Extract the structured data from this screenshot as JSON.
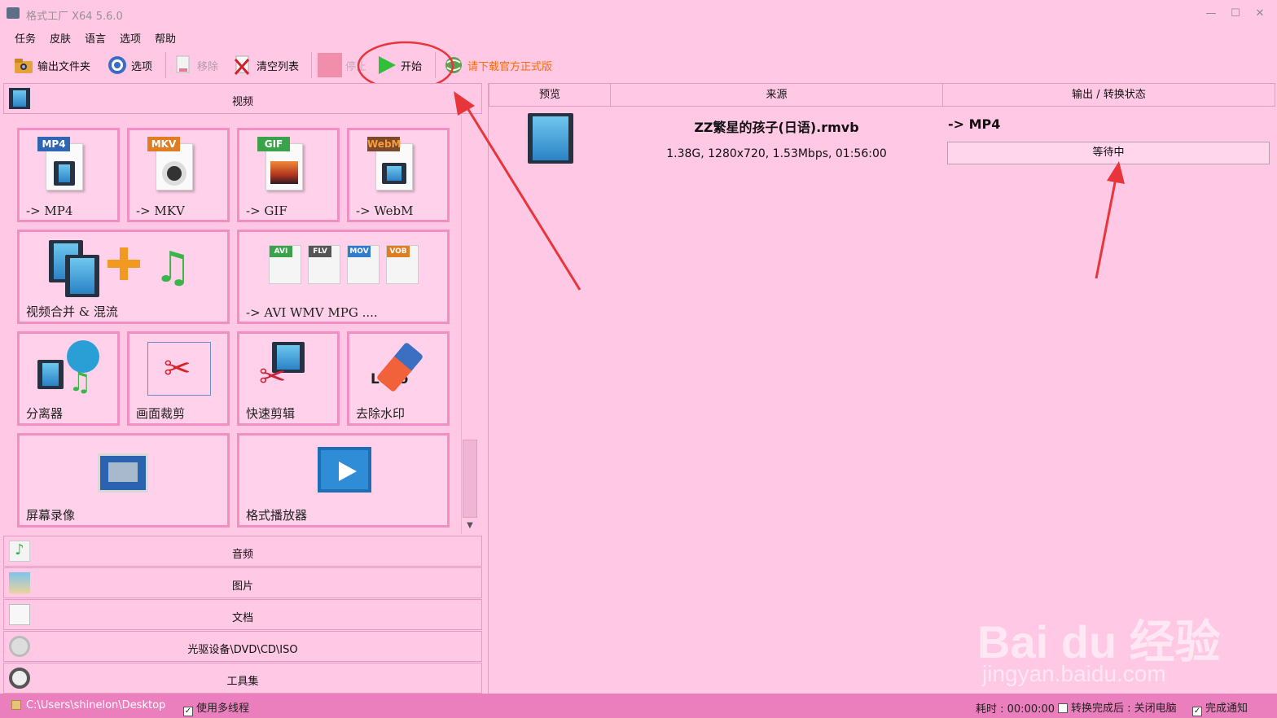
{
  "window": {
    "title": "格式工厂 X64 5.6.0",
    "controls": [
      "—",
      "☐",
      "✕"
    ]
  },
  "menu": [
    "任务",
    "皮肤",
    "语言",
    "选项",
    "帮助"
  ],
  "toolbar": {
    "output_folder": "输出文件夹",
    "options": "选项",
    "remove": "移除",
    "clear_list": "清空列表",
    "stop": "停止",
    "start": "开始",
    "download": "请下载官方正式版"
  },
  "categories": {
    "video": "视频",
    "audio": "音频",
    "image": "图片",
    "document": "文档",
    "optical": "光驱设备\\DVD\\CD\\ISO",
    "tools": "工具集"
  },
  "tiles": [
    {
      "label": "-> MP4",
      "badge": "MP4"
    },
    {
      "label": "-> MKV",
      "badge": "MKV"
    },
    {
      "label": "-> GIF",
      "badge": "GIF"
    },
    {
      "label": "-> WebM",
      "badge": "WebM"
    },
    {
      "label": "视频合并 & 混流"
    },
    {
      "label": "-> AVI WMV MPG ....",
      "badges": [
        "AVI",
        "FLV",
        "MOV",
        "VOB"
      ]
    },
    {
      "label": "分离器"
    },
    {
      "label": "画面裁剪"
    },
    {
      "label": "快速剪辑"
    },
    {
      "label": "去除水印",
      "logo_text": "Logo"
    },
    {
      "label": "屏幕录像"
    },
    {
      "label": "格式播放器"
    }
  ],
  "task_list": {
    "headers": [
      "预览",
      "来源",
      "输出 / 转换状态"
    ],
    "rows": [
      {
        "filename": "ZZ繁星的孩子(日语).rmvb",
        "info": "1.38G, 1280x720, 1.53Mbps, 01:56:00",
        "output": "-> MP4",
        "status": "等待中"
      }
    ]
  },
  "statusbar": {
    "path": "C:\\Users\\shinelon\\Desktop",
    "multithread": "使用多线程",
    "multithread_checked": true,
    "elapsed": "耗时 : 00:00:00",
    "after_done": "转换完成后 : 关闭电脑",
    "after_done_checked": false,
    "notify": "完成通知",
    "notify_checked": true
  },
  "watermark": {
    "brand": "Bai du 经验",
    "url": "jingyan.baidu.com"
  },
  "colors": {
    "background": "#ffc9e6",
    "tile_border": "#f18fc3",
    "statusbar": "#eb7fbd",
    "annotation": "#e8353a",
    "start_green": "#2fbf3a",
    "download_orange": "#ff6a00"
  }
}
